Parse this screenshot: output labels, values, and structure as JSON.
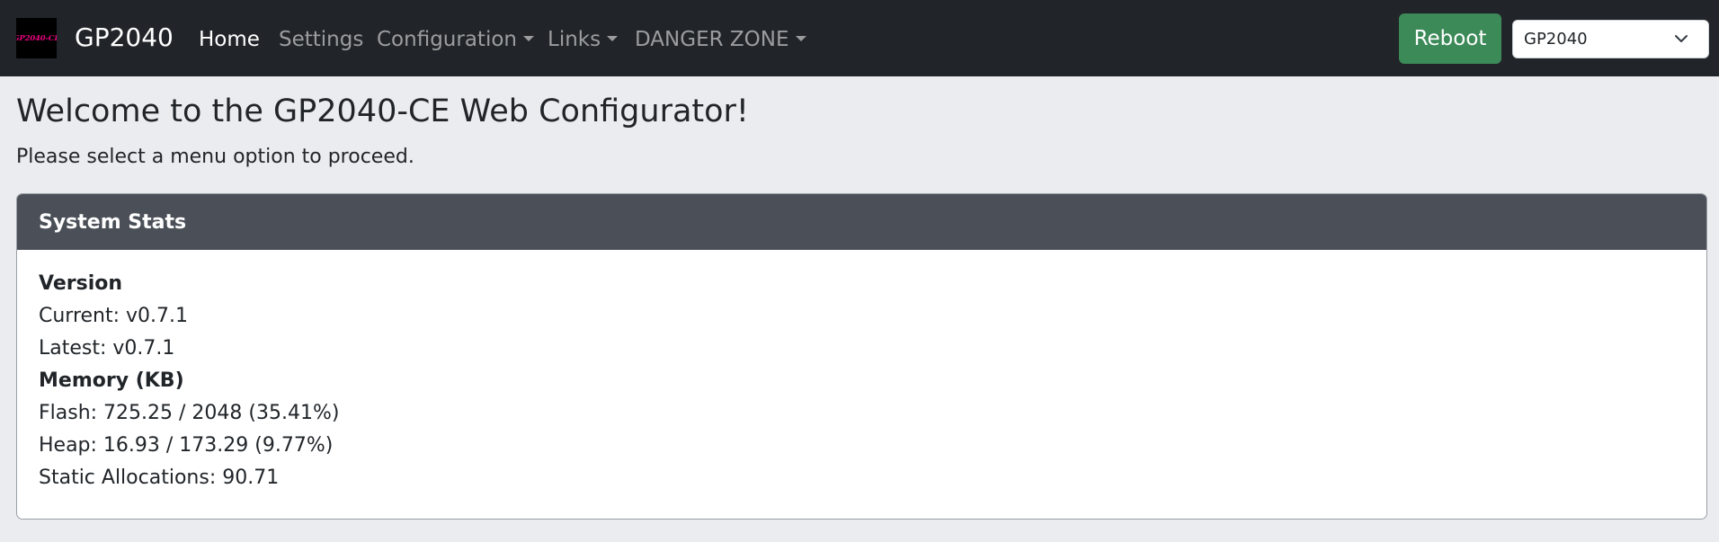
{
  "brand": {
    "logo_text": "GP2040-CE",
    "name": "GP2040"
  },
  "nav": {
    "items": [
      {
        "label": "Home",
        "active": true,
        "dropdown": false
      },
      {
        "label": "Settings",
        "active": false,
        "dropdown": false
      },
      {
        "label": "Configuration",
        "active": false,
        "dropdown": true
      },
      {
        "label": "Links",
        "active": false,
        "dropdown": true
      },
      {
        "label": "DANGER ZONE",
        "active": false,
        "dropdown": true
      }
    ]
  },
  "toolbar": {
    "reboot_label": "Reboot",
    "board_select_value": "GP2040"
  },
  "main": {
    "title": "Welcome to the GP2040-CE Web Configurator!",
    "subtitle": "Please select a menu option to proceed."
  },
  "stats": {
    "header": "System Stats",
    "version_heading": "Version",
    "current": "Current: v0.7.1",
    "latest": "Latest: v0.7.1",
    "memory_heading": "Memory (KB)",
    "flash": "Flash: 725.25 / 2048 (35.41%)",
    "heap": "Heap: 16.93 / 173.29 (9.77%)",
    "static_alloc": "Static Allocations: 90.71"
  },
  "colors": {
    "navbar_bg": "#212529",
    "reboot_bg": "#3d8a59",
    "card_header_bg": "#4b5058",
    "page_bg": "#ebecf0"
  }
}
